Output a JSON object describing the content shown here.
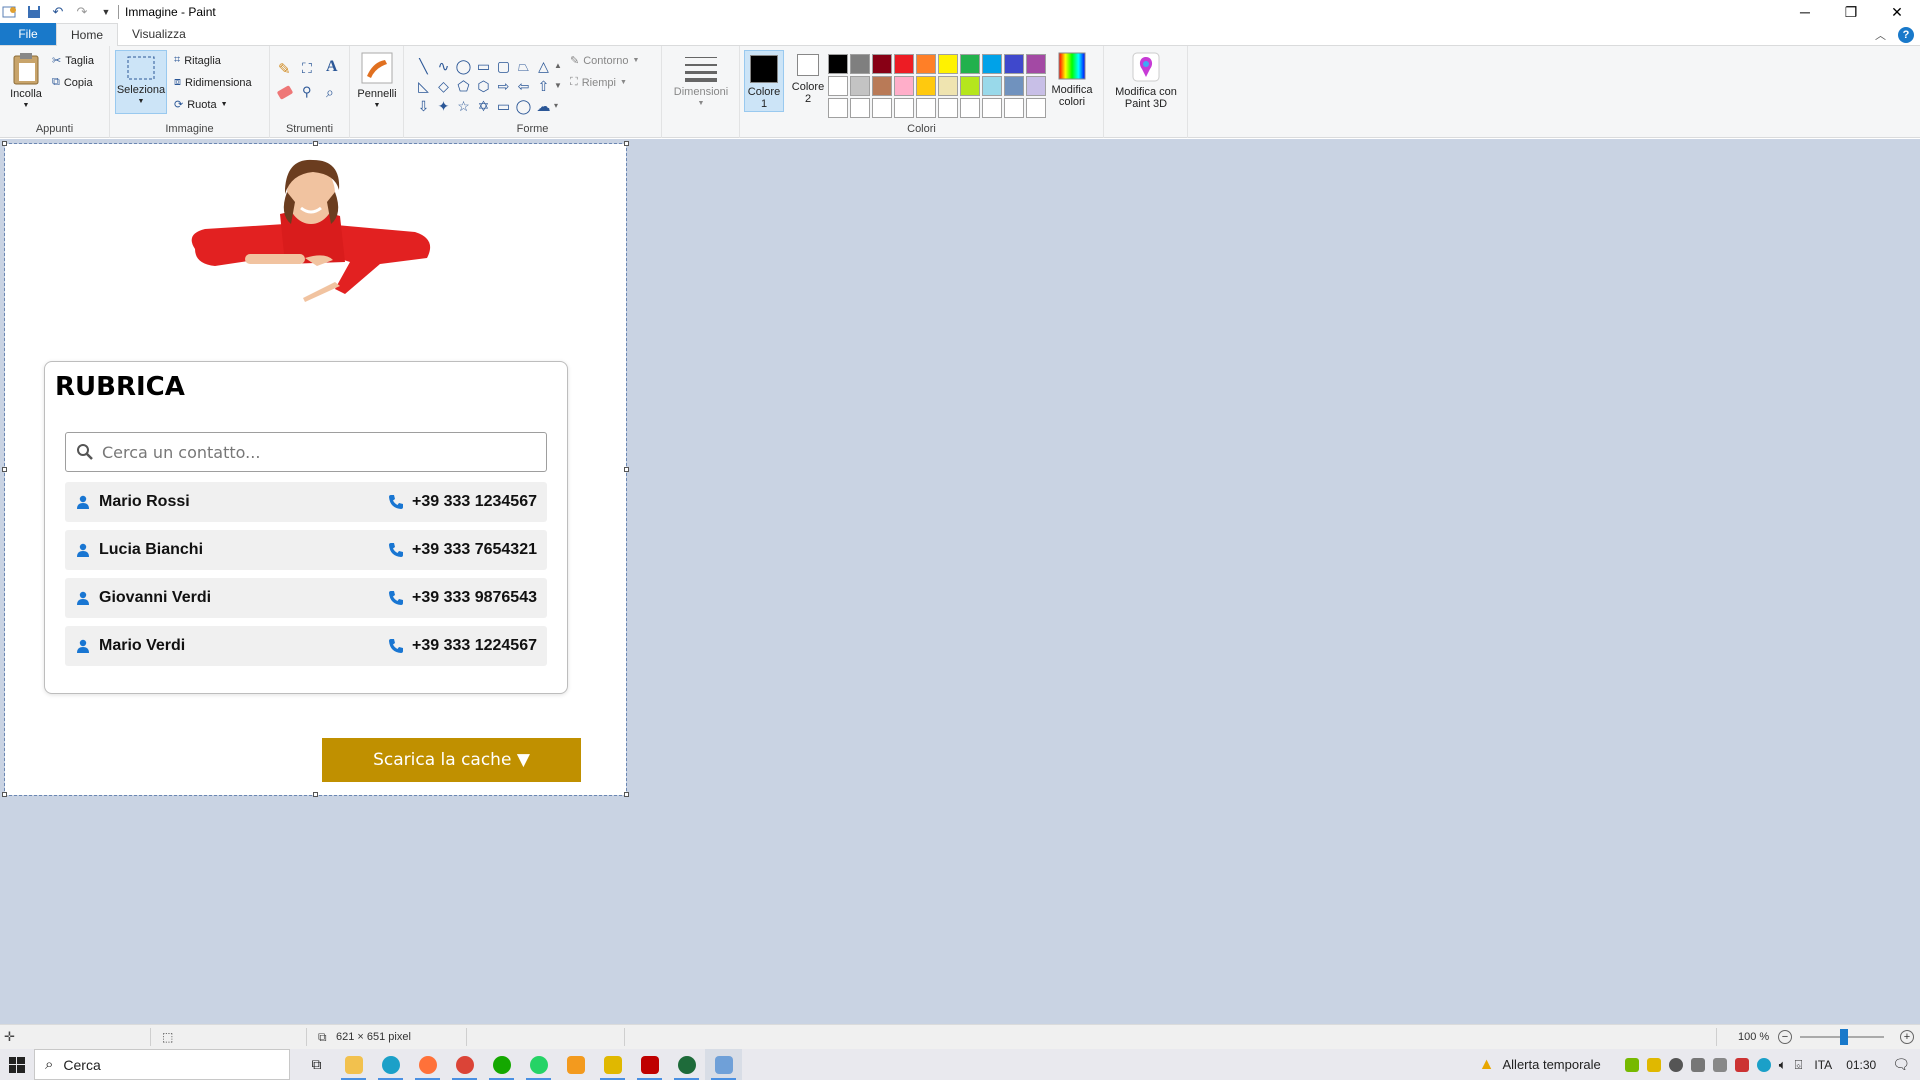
{
  "window": {
    "title": "Immagine - Paint",
    "controls": {
      "minimize": "─",
      "maximize": "❐",
      "close": "✕"
    }
  },
  "tabs": [
    {
      "label": "File"
    },
    {
      "label": "Home"
    },
    {
      "label": "Visualizza"
    }
  ],
  "ribbon": {
    "appunti": {
      "group_label": "Appunti",
      "paste": "Incolla",
      "cut": "Taglia",
      "copy": "Copia"
    },
    "immagine": {
      "group_label": "Immagine",
      "select": "Seleziona",
      "crop": "Ritaglia",
      "resize": "Ridimensiona",
      "rotate": "Ruota"
    },
    "strumenti": {
      "group_label": "Strumenti"
    },
    "pennelli": {
      "label": "Pennelli"
    },
    "forme": {
      "group_label": "Forme",
      "outline": "Contorno",
      "fill": "Riempi"
    },
    "dimensioni": {
      "label": "Dimensioni"
    },
    "colori": {
      "group_label": "Colori",
      "color1": "Colore 1",
      "color2": "Colore 2",
      "edit": "Modifica colori",
      "paint3d": "Modifica con Paint 3D",
      "palette_row1": [
        "#000000",
        "#7f7f7f",
        "#880015",
        "#ed1c24",
        "#ff7f27",
        "#fff200",
        "#22b14c",
        "#00a2e8",
        "#3f48cc",
        "#a349a4"
      ],
      "palette_row2": [
        "#ffffff",
        "#c3c3c3",
        "#b97a57",
        "#ffaec9",
        "#ffc90e",
        "#efe4b0",
        "#b5e61d",
        "#99d9ea",
        "#7092be",
        "#c8bfe7"
      ]
    }
  },
  "canvas": {
    "card_title": "RUBRICA",
    "search_placeholder": "Cerca un contatto...",
    "contacts": [
      {
        "name": "Mario Rossi",
        "phone": "+39 333 1234567"
      },
      {
        "name": "Lucia Bianchi",
        "phone": "+39 333 7654321"
      },
      {
        "name": "Giovanni Verdi",
        "phone": "+39 333 9876543"
      },
      {
        "name": "Mario Verdi",
        "phone": "+39 333 1224567"
      }
    ],
    "download_button": "Scarica la cache ▼"
  },
  "statusbar": {
    "dimensions": "621 × 651 pixel",
    "zoom": "100 %",
    "zoom_level": 1.0
  },
  "taskbar": {
    "search": "Cerca",
    "weather": "Allerta temporale",
    "language": "ITA",
    "time": "01:30"
  },
  "colors": {
    "accent_blue": "#1979ca",
    "download_gold": "#c09000",
    "contact_icon_blue": "#1976d2",
    "workspace": "#c9d3e3"
  }
}
